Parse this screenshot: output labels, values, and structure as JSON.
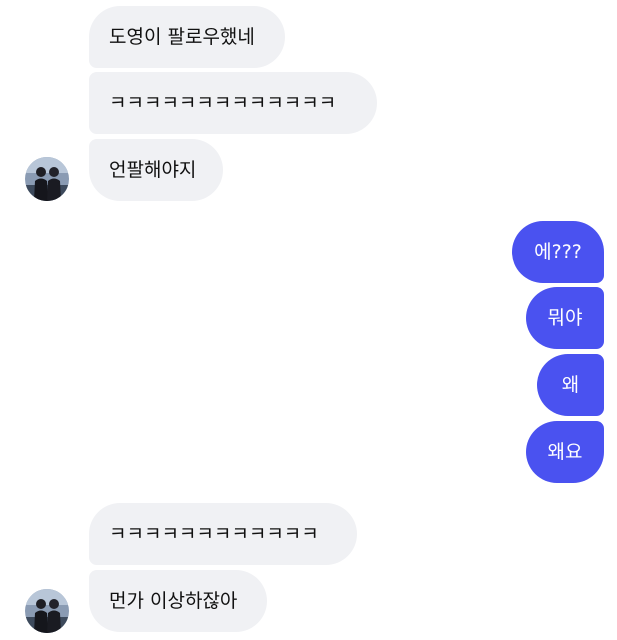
{
  "conversation": {
    "group1": {
      "messages": [
        "도영이 팔로우했네",
        "ㅋㅋㅋㅋㅋㅋㅋㅋㅋㅋㅋㅋㅋ",
        "언팔해야지"
      ]
    },
    "group2": {
      "messages": [
        "에???",
        "뭐야",
        "왜",
        "왜요"
      ]
    },
    "group3": {
      "messages": [
        "ㅋㅋㅋㅋㅋㅋㅋㅋㅋㅋㅋㅋ",
        "먼가 이상하잖아"
      ]
    }
  },
  "colors": {
    "incoming_bubble": "#f0f1f4",
    "outgoing_bubble": "#4a52f0",
    "incoming_text": "#111111",
    "outgoing_text": "#ffffff"
  }
}
